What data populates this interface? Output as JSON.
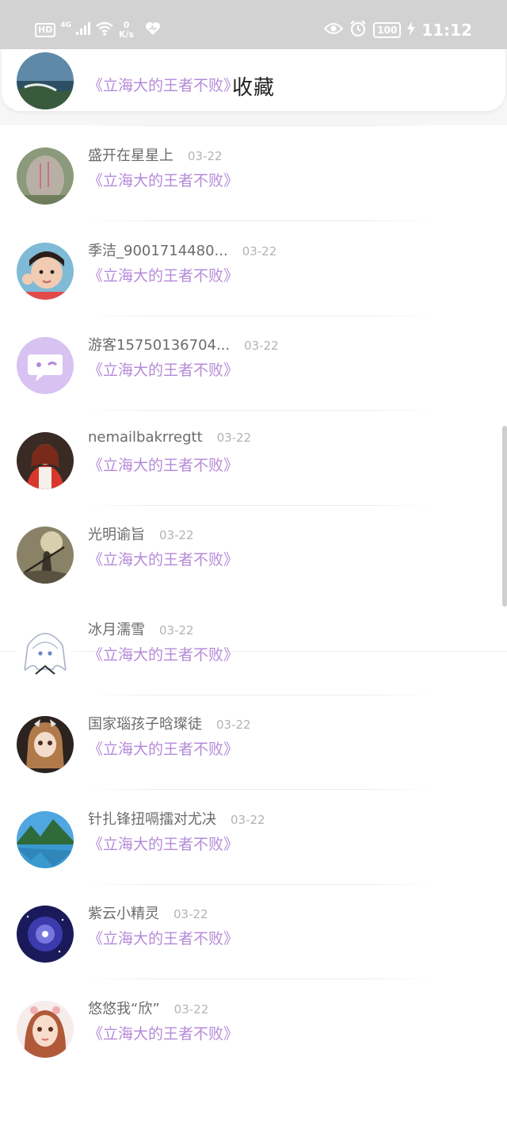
{
  "status_bar": {
    "hd": "HD",
    "network": "4G",
    "speed_value": "0",
    "speed_unit": "K/s",
    "battery": "100",
    "time": "11:12",
    "icons": [
      "signal-icon",
      "wifi-icon",
      "heart-icon",
      "eye-icon",
      "alarm-icon",
      "charging-icon"
    ]
  },
  "header": {
    "title": "收藏",
    "back_icon": "chevron-left-icon",
    "accent_color": "#2a9df4"
  },
  "list": {
    "items": [
      {
        "username": "",
        "date": "",
        "book": "《立海大的王者不败》",
        "avatar": "coast-landscape"
      },
      {
        "username": "盛开在星星上",
        "date": "03-22",
        "book": "《立海大的王者不败》",
        "avatar": "stone-tablet"
      },
      {
        "username": "季洁_9001714480...",
        "date": "03-22",
        "book": "《立海大的王者不败》",
        "avatar": "girl-photo"
      },
      {
        "username": "游客15750136704...",
        "date": "03-22",
        "book": "《立海大的王者不败》",
        "avatar": "default-chat-avatar"
      },
      {
        "username": "nemailbakrregtt",
        "date": "03-22",
        "book": "《立海大的王者不败》",
        "avatar": "girl-red-coat"
      },
      {
        "username": "光明谕旨",
        "date": "03-22",
        "book": "《立海大的王者不败》",
        "avatar": "warrior-art"
      },
      {
        "username": "冰月濡雪",
        "date": "03-22",
        "book": "《立海大的王者不败》",
        "avatar": "anime-sketch"
      },
      {
        "username": "国家瑙孩子晗璨徒",
        "date": "03-22",
        "book": "《立海大的王者不败》",
        "avatar": "doll"
      },
      {
        "username": "针扎锋扭嗝擂对尤决",
        "date": "03-22",
        "book": "《立海大的王者不败》",
        "avatar": "mountain-lake"
      },
      {
        "username": "紫云小精灵",
        "date": "03-22",
        "book": "《立海大的王者不败》",
        "avatar": "galaxy"
      },
      {
        "username": "悠悠我“欣”",
        "date": "03-22",
        "book": "《立海大的王者不败》",
        "avatar": "cartoon-girl"
      }
    ]
  },
  "colors": {
    "book_title": "#b58ad9",
    "username": "#6b6b6b",
    "date": "#b3b3b3",
    "status_bar_bg": "#d2d2d2"
  }
}
